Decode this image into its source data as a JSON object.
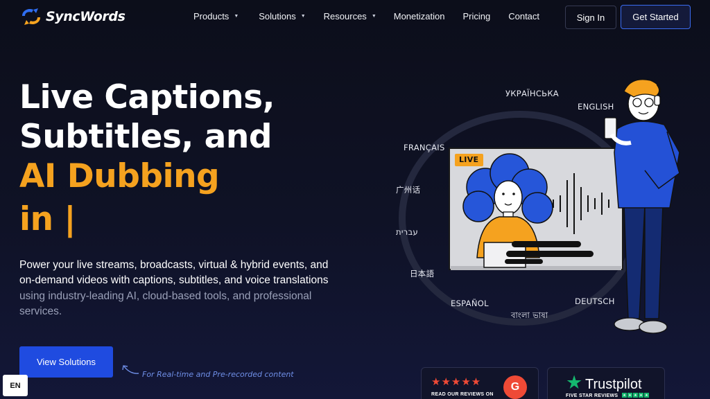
{
  "brand": {
    "name": "SyncWords"
  },
  "nav": {
    "items": [
      {
        "label": "Products",
        "dropdown": true
      },
      {
        "label": "Solutions",
        "dropdown": true
      },
      {
        "label": "Resources",
        "dropdown": true
      },
      {
        "label": "Monetization",
        "dropdown": false
      },
      {
        "label": "Pricing",
        "dropdown": false
      },
      {
        "label": "Contact",
        "dropdown": false
      }
    ],
    "signin_label": "Sign In",
    "start_label": "Get Started"
  },
  "hero": {
    "line1": "Live Captions,",
    "line2": "Subtitles, and",
    "line3": "AI Dubbing",
    "line4": "in |",
    "desc_main": "Power your live streams, broadcasts, virtual & hybrid events, and on-demand videos with captions, subtitles, and voice translations",
    "desc_muted": " using industry-leading AI, cloud-based tools, and professional services.",
    "cta_label": "View Solutions",
    "note": "For Real-time and Pre-recorded content"
  },
  "languages": [
    "УКРАЇНСЬКА",
    "ENGLISH",
    "FRANÇAIS",
    "广州话",
    "עברית",
    "日本語",
    "ESPAÑOL",
    "বাংলা ভাষা",
    "DEUTSCH"
  ],
  "illustration": {
    "live_label": "LIVE"
  },
  "badges": {
    "g2_label": "READ OUR REVIEWS ON",
    "g2_stars": "★★★★★",
    "g2_mark": "G",
    "tp_name": "Trustpilot",
    "tp_sub": "FIVE STAR REVIEWS"
  },
  "language_selector": "EN",
  "colors": {
    "accent": "#f5a21f",
    "primary": "#1f4be0",
    "background": "#0d0f1e"
  }
}
